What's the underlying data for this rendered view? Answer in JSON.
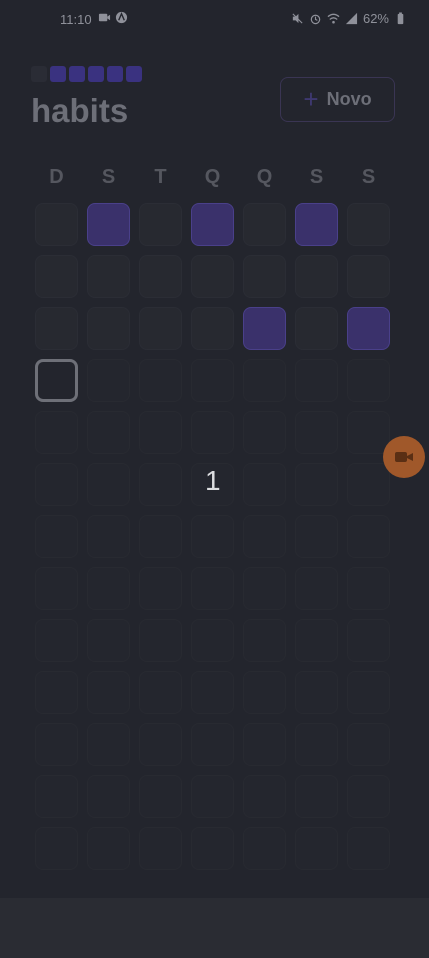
{
  "status_bar": {
    "time": "11:10",
    "battery": "62%"
  },
  "header": {
    "title": "habits",
    "new_button_label": "Novo"
  },
  "week_days": [
    "D",
    "S",
    "T",
    "Q",
    "Q",
    "S",
    "S"
  ],
  "overlay": {
    "count": "1"
  },
  "colors": {
    "accent": "#3a316b",
    "background": "#23252d",
    "record": "#a0582a"
  },
  "habit_grid": {
    "rows": 13,
    "completed": [
      [
        0,
        1
      ],
      [
        0,
        3
      ],
      [
        0,
        5
      ],
      [
        2,
        4
      ],
      [
        2,
        6
      ]
    ],
    "today": [
      3,
      0
    ]
  }
}
